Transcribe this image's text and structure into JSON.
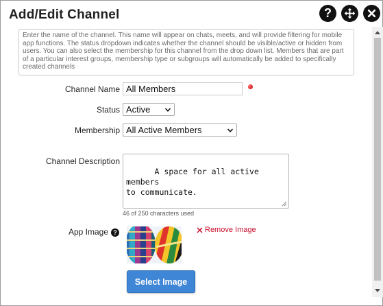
{
  "dialog": {
    "title": "Add/Edit Channel",
    "help_icon": "question-circle-icon",
    "move_icon": "move-arrows-icon",
    "close_icon": "close-x-icon"
  },
  "info_text": "Enter the name of the channel. This name will appear on chats, meets, and will provide filtering for mobile app functions. The status dropdown indicates whether the channel should be visible/active or hidden from users. You can also select the membership for this channel from the drop down list. Members that are part of a particular interest groups, membership type or subgroups will automatically be added to specifically created channels",
  "form": {
    "channel_name": {
      "label": "Channel Name",
      "value": "All Members",
      "required_color": "#c00000"
    },
    "status": {
      "label": "Status",
      "value": "Active"
    },
    "membership": {
      "label": "Membership",
      "value": "All Active Members"
    },
    "description": {
      "label": "Channel Description",
      "value": "A space for all active members\nto communicate.",
      "counter": "46 of 250 characters used"
    },
    "app_image": {
      "label": "App Image",
      "remove_label": "Remove Image",
      "select_label": "Select Image"
    }
  },
  "colors": {
    "accent": "#3f86d6",
    "remove_link": "#c8102e"
  }
}
